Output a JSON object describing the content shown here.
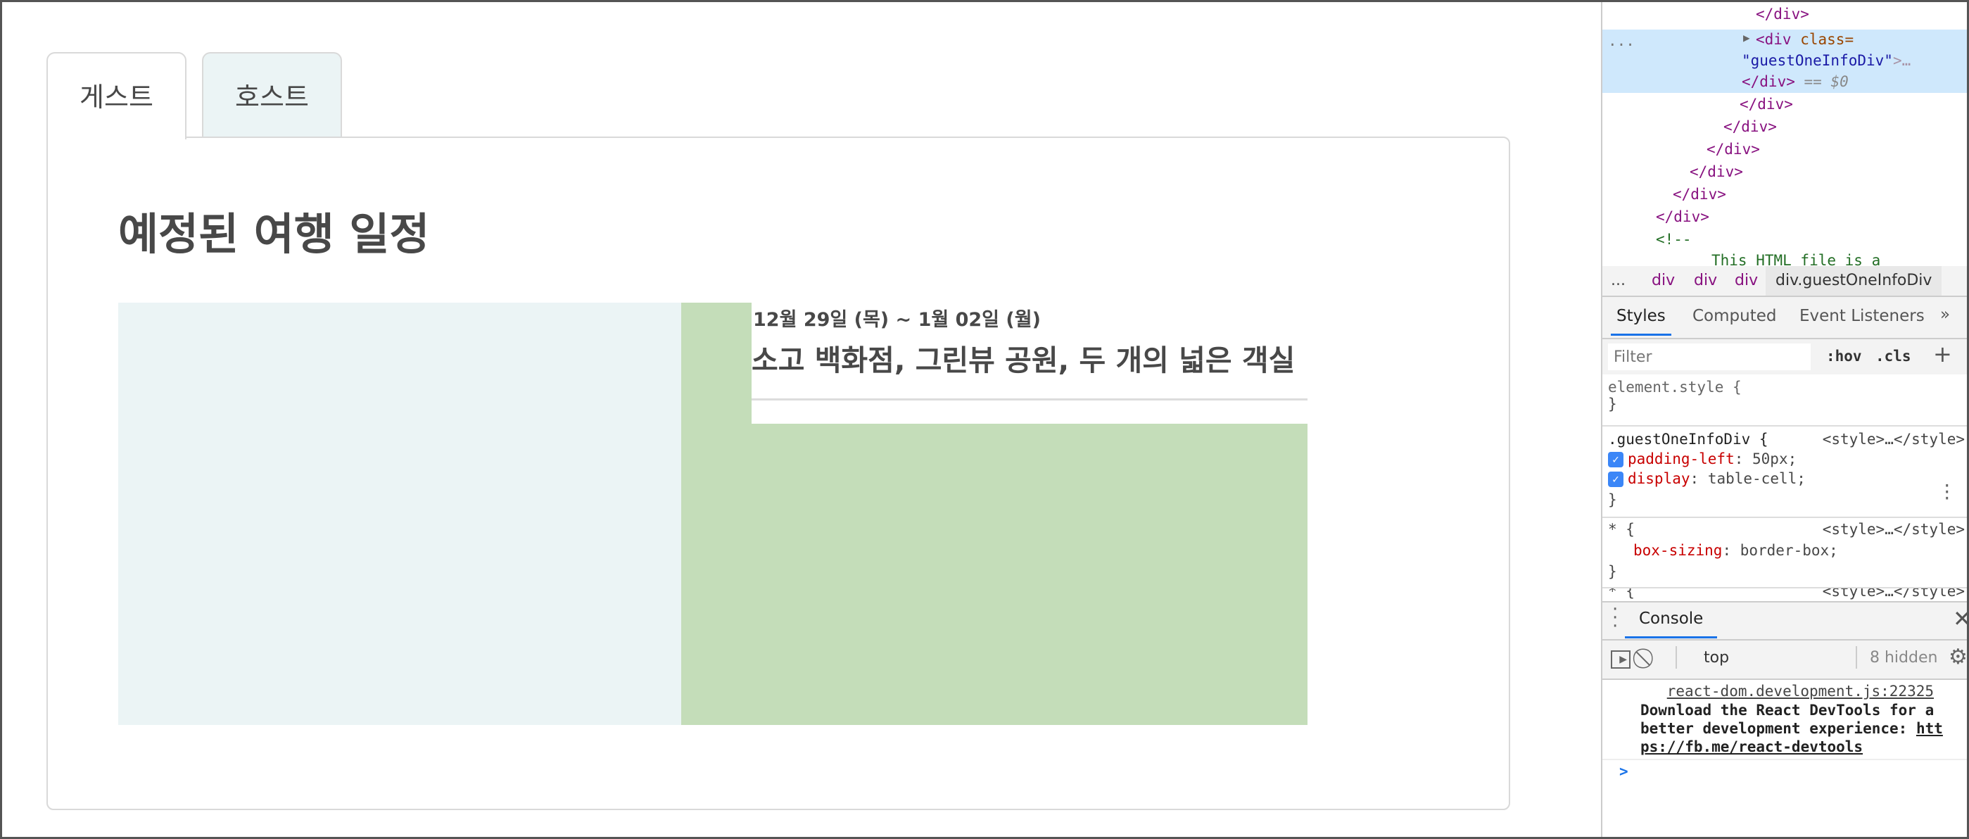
{
  "tabs": [
    {
      "label": "게스트",
      "active": true
    },
    {
      "label": "호스트",
      "active": false
    }
  ],
  "main": {
    "title": "예정된 여행 일정",
    "trip": {
      "dates": "12월 29일 (목) ~ 1월 02일 (월)",
      "name": "소고 백화점, 그린뷰 공원, 두 개의 넓은 객실"
    }
  },
  "colors": {
    "image_placeholder": "#ebf4f5",
    "info_cell": "#c4ddb9",
    "text": "#484848"
  },
  "devtools": {
    "elements": {
      "close1": "</div>",
      "open_tag": "<div",
      "attr_name": "class=",
      "attr_value": "\"guestOneInfoDiv\"",
      "ellipsis": ">…",
      "close_sel": "</div>",
      "sel_marker": "== $0",
      "closes": [
        "</div>",
        "</div>",
        "</div>",
        "</div>",
        "</div>",
        "</div>"
      ],
      "comment_open": "<!--",
      "comment_text": "This HTML file is a",
      "row_dots": "..."
    },
    "breadcrumb": [
      "...",
      "div",
      "div",
      "div",
      "div.guestOneInfoDiv"
    ],
    "style_tabs": [
      "Styles",
      "Computed",
      "Event Listeners",
      "»"
    ],
    "filter_placeholder": "Filter",
    "hov": ":hov",
    "cls": ".cls",
    "plus": "+",
    "rules": [
      {
        "selector": "element.style {",
        "close": "}"
      },
      {
        "selector": ".guestOneInfoDiv {",
        "source": "<style>…</style>",
        "props": [
          {
            "name": "padding-left",
            "value": "50px;"
          },
          {
            "name": "display",
            "value": "table-cell;"
          }
        ],
        "close": "}"
      },
      {
        "selector": "* {",
        "source": "<style>…</style>",
        "props": [
          {
            "name": "box-sizing",
            "value": "border-box;"
          }
        ],
        "close": "}"
      },
      {
        "selector": "* {",
        "source": "<style>…</style>"
      }
    ],
    "console": {
      "tab": "Console",
      "context": "top",
      "hidden": "8 hidden",
      "source": "react-dom.development.js:22325",
      "message": "Download the React DevTools for a better development experience: ",
      "link": "https://fb.me/react-devtools",
      "prompt": ">"
    }
  }
}
